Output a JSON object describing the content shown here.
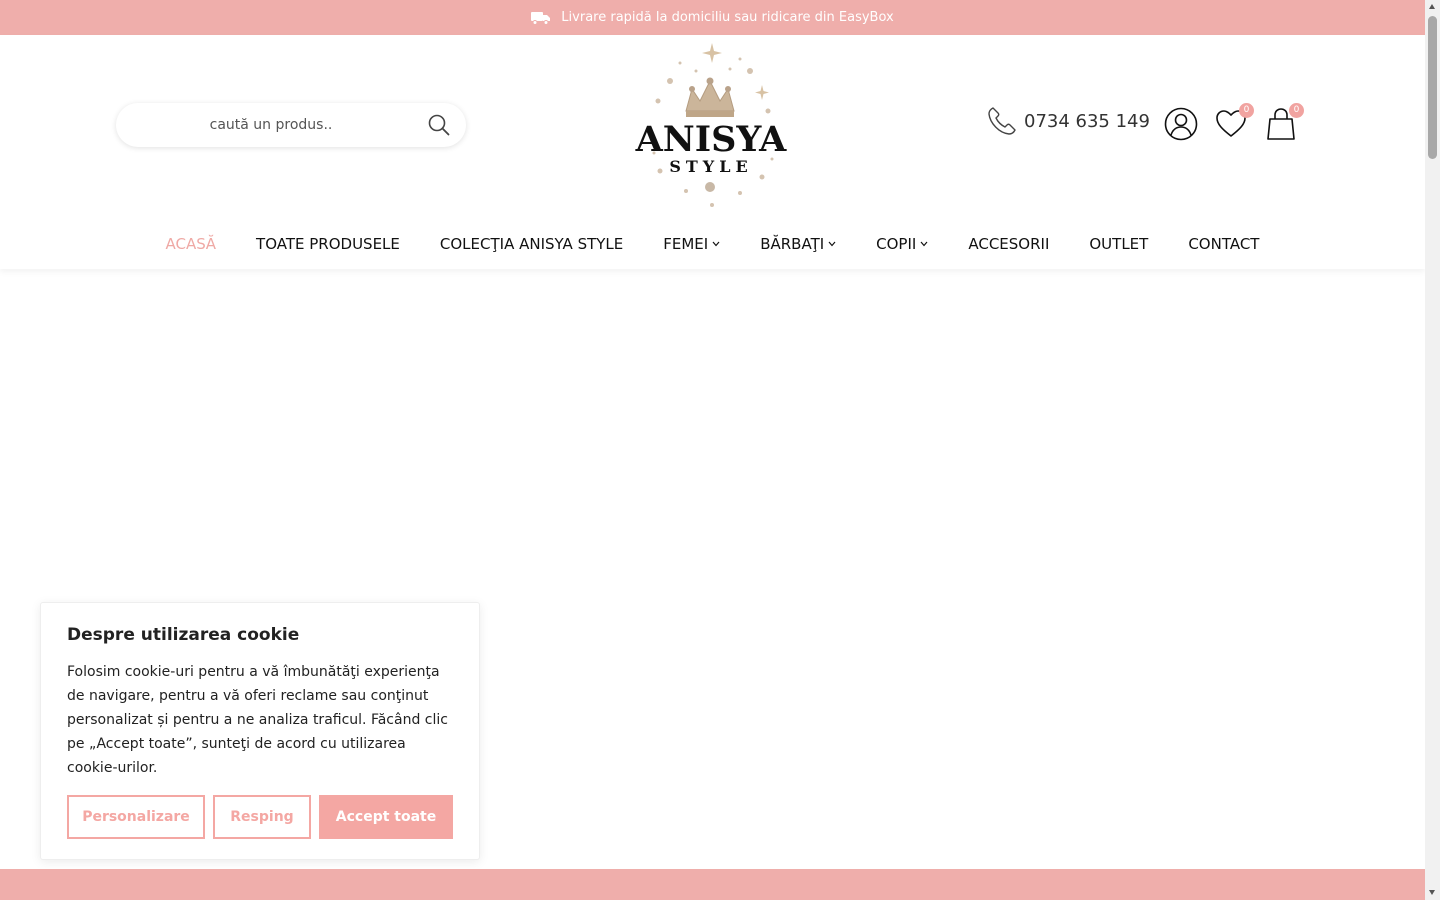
{
  "topbar": {
    "text": "Livrare rapidă la domiciliu sau ridicare din EasyBox",
    "icon": "truck-icon",
    "background": "#efaeab"
  },
  "header": {
    "search": {
      "placeholder": "caută un produs..",
      "icon": "search-icon"
    },
    "logo": {
      "name": "ANISYA",
      "subtitle": "STYLE"
    },
    "phone": {
      "number": "0734 635 149",
      "icon": "phone-icon"
    },
    "account": {
      "icon": "user-icon"
    },
    "wishlist": {
      "icon": "heart-icon",
      "count": "0"
    },
    "cart": {
      "icon": "shopping-bag-icon",
      "count": "0"
    }
  },
  "nav": {
    "items": [
      {
        "label": "ACASĂ",
        "active": true,
        "dropdown": false
      },
      {
        "label": "TOATE PRODUSELE",
        "active": false,
        "dropdown": false
      },
      {
        "label": "COLECŢIA ANISYA STYLE",
        "active": false,
        "dropdown": false
      },
      {
        "label": "FEMEI",
        "active": false,
        "dropdown": true
      },
      {
        "label": "BĂRBAŢI",
        "active": false,
        "dropdown": true
      },
      {
        "label": "COPII",
        "active": false,
        "dropdown": true
      },
      {
        "label": "ACCESORII",
        "active": false,
        "dropdown": false
      },
      {
        "label": "OUTLET",
        "active": false,
        "dropdown": false
      },
      {
        "label": "CONTACT",
        "active": false,
        "dropdown": false
      }
    ],
    "active_color": "#efa9a5"
  },
  "cookie": {
    "title": "Despre utilizarea cookie",
    "body": "Folosim cookie-uri pentru a vă îmbunătăţi experienţa de navigare, pentru a vă oferi reclame sau conţinut personalizat și pentru a ne analiza traficul. Făcând clic pe „Accept toate”, sunteţi de acord cu utilizarea cookie-urilor.",
    "buttons": {
      "customize": "Personalizare",
      "reject": "Resping",
      "accept": "Accept toate"
    },
    "accent": "#f4a7a3"
  }
}
